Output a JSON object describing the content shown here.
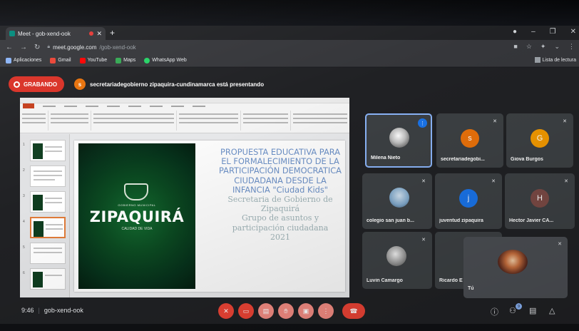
{
  "browser": {
    "tab_title": "Meet - gob-xend-ook",
    "url_domain": "meet.google.com",
    "url_path": "/gob-xend-ook",
    "bookmarks": [
      {
        "label": "Aplicaciones",
        "color": "#8ab4f8"
      },
      {
        "label": "Gmail",
        "color": "#ea4335"
      },
      {
        "label": "YouTube",
        "color": "#ff0000"
      },
      {
        "label": "Maps",
        "color": "#34a853"
      },
      {
        "label": "WhatsApp Web",
        "color": "#25d366"
      }
    ],
    "reading_list": "Lista de lectura"
  },
  "meet": {
    "recording_label": "GRABANDO",
    "presenter_initial": "s",
    "presenter_text": "secretariadegobierno zipaquira-cundinamarca está presentando",
    "meeting_time": "9:46",
    "meeting_code": "gob-xend-ook",
    "participants_badge": "9"
  },
  "slide": {
    "cover_gov_label": "GOBIERNO MUNICIPAL",
    "cover_city": "ZIPAQUIRÁ",
    "cover_tagline": "CALIDAD DE VIDA",
    "title_lines": [
      "PROPUESTA EDUCATIVA PARA",
      "EL FORMALECIMIENTO DE LA",
      "PARTICIPACIÓN DEMOCRATICA",
      "CIUDADANA DESDE LA",
      "INFANCIA \"Ciudad Kids\""
    ],
    "body_lines": [
      "Secretaria de Gobierno de",
      "Zipaquirá",
      "Grupo de asuntos y",
      "participación ciudadana",
      "2021"
    ]
  },
  "participants": [
    {
      "name": "Milena Nieto",
      "initial": "",
      "color": "#5f6368"
    },
    {
      "name": "secretariadegobi...",
      "initial": "s",
      "color": "#e8710a"
    },
    {
      "name": "Giova Burgos",
      "initial": "G",
      "color": "#f29900"
    },
    {
      "name": "colegio san juan b...",
      "initial": "",
      "color": "#7fa7c9"
    },
    {
      "name": "juventud zipaquira",
      "initial": "j",
      "color": "#1a73e8"
    },
    {
      "name": "Hector Javier CA...",
      "initial": "H",
      "color": "#7b4a45"
    },
    {
      "name": "Luvin Camargo",
      "initial": "",
      "color": "#9e9e9e"
    },
    {
      "name": "Ricardo E",
      "initial": "",
      "color": "#5f6368"
    }
  ],
  "self_tile": {
    "name": "Tú"
  },
  "colors": {
    "recording": "#d93025",
    "speaking": "#1a73e8",
    "end_call": "#ea4335"
  },
  "icons": {
    "mic": "microphone-off-icon",
    "camera": "camera-off-icon",
    "captions": "captions-icon",
    "raise_hand": "raise-hand-icon",
    "present": "present-icon",
    "more": "more-icon",
    "end": "end-call-icon"
  }
}
